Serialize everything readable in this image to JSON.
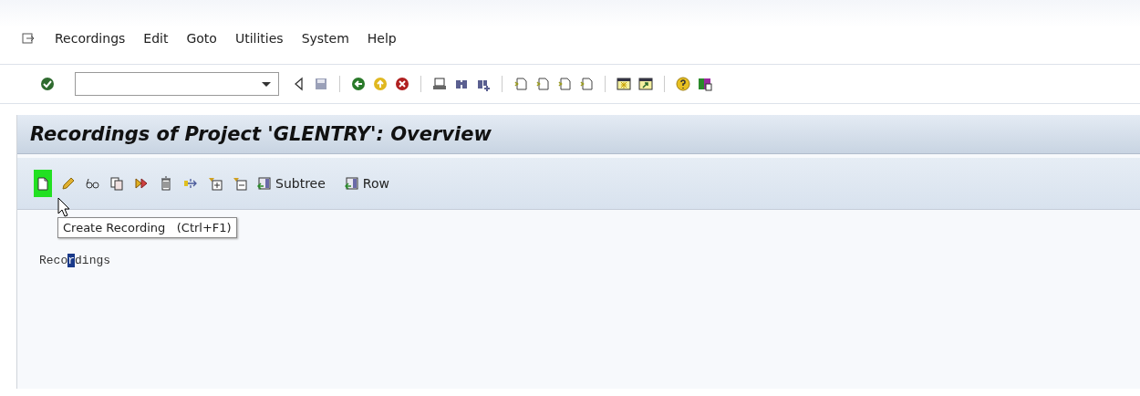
{
  "menu_bar": {
    "items": [
      {
        "label": "Recordings"
      },
      {
        "label": "Edit"
      },
      {
        "label": "Goto"
      },
      {
        "label": "Utilities"
      },
      {
        "label": "System"
      },
      {
        "label": "Help"
      }
    ]
  },
  "title": "Recordings of Project 'GLENTRY': Overview",
  "app_toolbar": [
    {
      "kind": "create",
      "hovered": true
    },
    {
      "kind": "edit",
      "hovered": false
    },
    {
      "kind": "glasses",
      "hovered": false
    },
    {
      "kind": "copy",
      "hovered": false
    },
    {
      "kind": "run",
      "hovered": false
    },
    {
      "kind": "delete",
      "hovered": false
    },
    {
      "kind": "move",
      "hovered": false
    },
    {
      "kind": "expand",
      "hovered": false
    },
    {
      "kind": "collapse",
      "hovered": false
    },
    {
      "kind": "tree",
      "hovered": false,
      "label": "Subtree"
    },
    {
      "kind": "tree",
      "hovered": false,
      "label": "Row"
    }
  ],
  "tooltip": {
    "text": "Create Recording",
    "shortcut": "(Ctrl+F1)"
  },
  "tree_text": {
    "before": "Reco",
    "at": "r",
    "after": "dings"
  }
}
